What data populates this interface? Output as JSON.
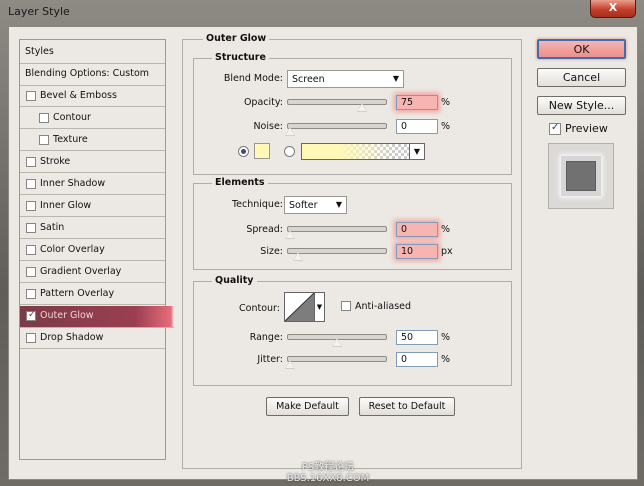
{
  "window": {
    "title": "Layer Style",
    "close_glyph": "X"
  },
  "styles_list": {
    "header": "Styles",
    "blending": "Blending Options: Custom",
    "items": [
      {
        "label": "Bevel & Emboss",
        "checked": false
      },
      {
        "label": "Contour",
        "checked": false
      },
      {
        "label": "Texture",
        "checked": false
      },
      {
        "label": "Stroke",
        "checked": false
      },
      {
        "label": "Inner Shadow",
        "checked": false
      },
      {
        "label": "Inner Glow",
        "checked": false
      },
      {
        "label": "Satin",
        "checked": false
      },
      {
        "label": "Color Overlay",
        "checked": false
      },
      {
        "label": "Gradient Overlay",
        "checked": false
      },
      {
        "label": "Pattern Overlay",
        "checked": false
      },
      {
        "label": "Outer Glow",
        "checked": true
      },
      {
        "label": "Drop Shadow",
        "checked": false
      }
    ],
    "check_glyph": "✓"
  },
  "outer_glow": {
    "title": "Outer Glow",
    "structure": {
      "title": "Structure",
      "blend_mode_label": "Blend Mode:",
      "blend_mode": "Screen",
      "opacity_label": "Opacity:",
      "opacity": "75",
      "opacity_unit": "%",
      "noise_label": "Noise:",
      "noise": "0",
      "noise_unit": "%",
      "swatch_color": "#fff8b6"
    },
    "elements": {
      "title": "Elements",
      "technique_label": "Technique:",
      "technique": "Softer",
      "spread_label": "Spread:",
      "spread": "0",
      "spread_unit": "%",
      "size_label": "Size:",
      "size": "10",
      "size_unit": "px"
    },
    "quality": {
      "title": "Quality",
      "contour_label": "Contour:",
      "anti_aliased_label": "Anti-aliased",
      "range_label": "Range:",
      "range": "50",
      "range_unit": "%",
      "jitter_label": "Jitter:",
      "jitter": "0",
      "jitter_unit": "%"
    },
    "make_default": "Make Default",
    "reset_default": "Reset to Default"
  },
  "actions": {
    "ok": "OK",
    "cancel": "Cancel",
    "new_style": "New Style...",
    "preview_label": "Preview",
    "preview_checked": true
  },
  "watermark": {
    "line1": "PS教程论坛",
    "line2": "BBS.16XX8.COM"
  },
  "colors": {
    "selection": "#9b3f52",
    "highlight": "#f8b4b0",
    "preview_swatch": "#717171"
  }
}
